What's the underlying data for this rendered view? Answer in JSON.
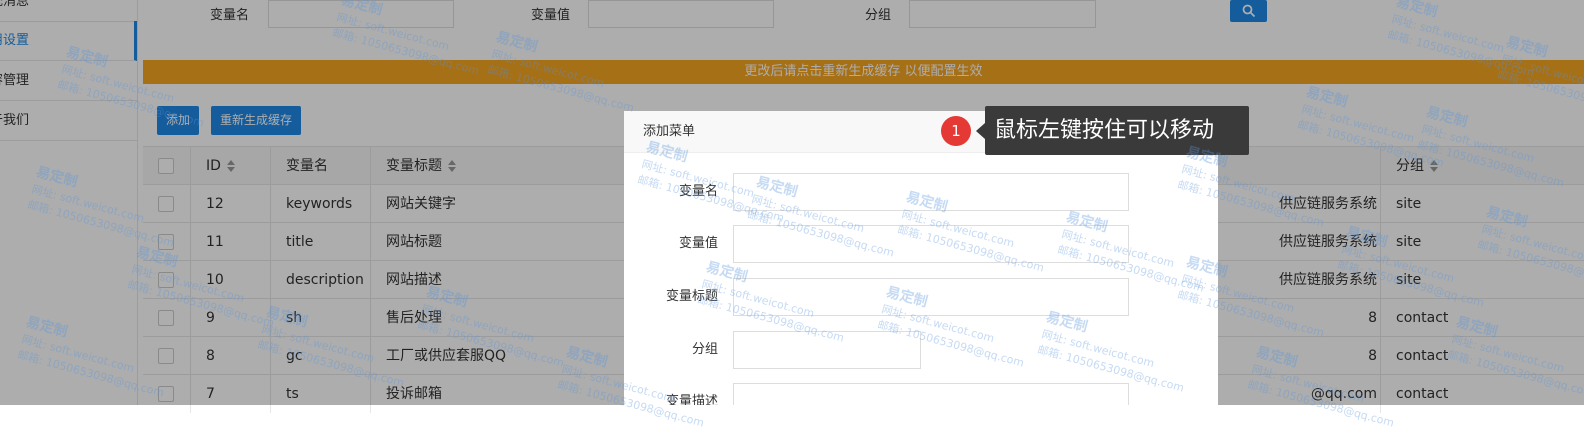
{
  "sidebar": {
    "items": [
      {
        "label": "统消息"
      },
      {
        "label": "用设置"
      },
      {
        "label": "容管理"
      },
      {
        "label": "于我们"
      }
    ]
  },
  "search": {
    "fields": [
      {
        "label": "变量名"
      },
      {
        "label": "变量值"
      },
      {
        "label": "分组"
      }
    ],
    "button_icon": "search-icon"
  },
  "notice": {
    "text": "更改后请点击重新生成缓存 以便配置生效"
  },
  "toolbar": {
    "add_label": "添加",
    "regen_label": "重新生成缓存"
  },
  "table": {
    "columns": [
      "ID",
      "变量名",
      "变量标题",
      "分组"
    ],
    "rows": [
      {
        "id": "12",
        "name": "keywords",
        "title": "网站关键字",
        "value": "供应链服务系统",
        "group": "site"
      },
      {
        "id": "11",
        "name": "title",
        "title": "网站标题",
        "value": "供应链服务系统",
        "group": "site"
      },
      {
        "id": "10",
        "name": "description",
        "title": "网站描述",
        "value": "供应链服务系统",
        "group": "site"
      },
      {
        "id": "9",
        "name": "sh",
        "title": "售后处理",
        "value": "8",
        "group": "contact"
      },
      {
        "id": "8",
        "name": "gc",
        "title": "工厂或供应套服QQ",
        "value": "8",
        "group": "contact"
      },
      {
        "id": "7",
        "name": "ts",
        "title": "投诉邮箱",
        "value": "@qq.com",
        "group": "contact"
      }
    ]
  },
  "dialog": {
    "title": "添加菜单",
    "fields": [
      {
        "label": "变量名"
      },
      {
        "label": "变量值"
      },
      {
        "label": "变量标题"
      },
      {
        "label": "分组"
      },
      {
        "label": "变量描述"
      }
    ]
  },
  "tooltip": {
    "step": "1",
    "text": "鼠标左键按住可以移动"
  },
  "watermark": {
    "brand": "易定制",
    "site": "网址: soft.weicot.com",
    "mail": "邮箱: 1050653098@qq.com"
  },
  "colors": {
    "primary": "#1e88e5",
    "notice": "#f5a623",
    "badge": "#e53935"
  }
}
